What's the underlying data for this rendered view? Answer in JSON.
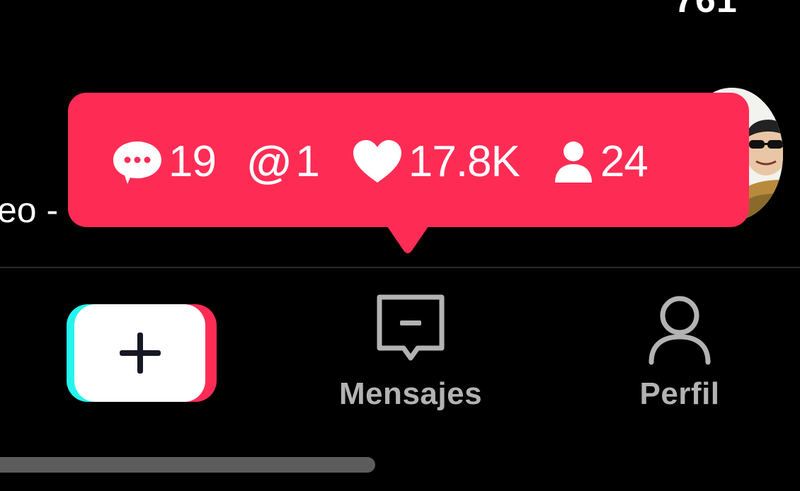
{
  "top_count": "761",
  "caption_partial": "eo -",
  "notification": {
    "comments": {
      "icon": "comment-bubble-icon",
      "value": "19"
    },
    "mentions": {
      "icon": "at-mention-icon",
      "symbol": "@",
      "value": "1"
    },
    "likes": {
      "icon": "heart-icon",
      "value": "17.8K"
    },
    "followers": {
      "icon": "person-icon",
      "value": "24"
    }
  },
  "nav": {
    "create": {
      "icon": "plus-icon"
    },
    "messages": {
      "icon": "inbox-icon",
      "label": "Mensajes"
    },
    "profile": {
      "icon": "profile-icon",
      "label": "Perfil"
    }
  },
  "colors": {
    "accent_pink": "#fe2c55",
    "accent_cyan": "#25f4ee",
    "background": "#000000",
    "nav_label": "#b3b3b3"
  }
}
